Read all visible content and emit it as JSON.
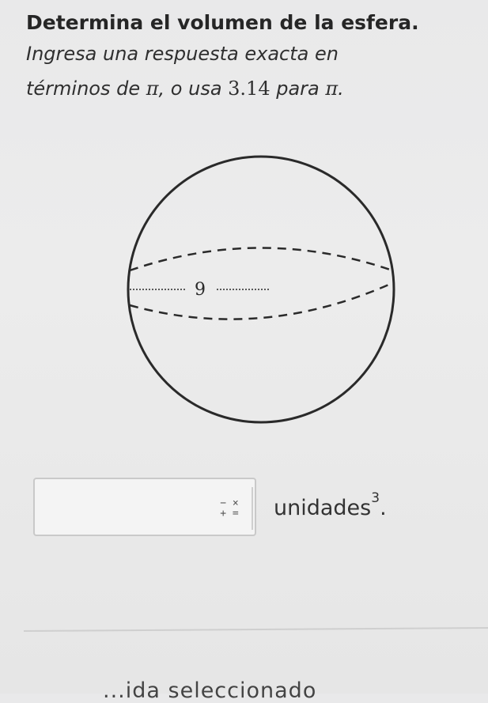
{
  "question": {
    "title": "Determina el volumen de la esfera.",
    "line1": "Ingresa una respuesta exacta en",
    "line2_prefix": "términos de ",
    "line2_pi": "π",
    "line2_mid": ", o usa ",
    "line2_num": "3.14",
    "line2_mid2": " para ",
    "line2_pi2": "π",
    "line2_end": "."
  },
  "figure": {
    "radius_label": "9"
  },
  "answer": {
    "value": "",
    "placeholder": "",
    "keypad_top": "− ×",
    "keypad_bottom": "+ =",
    "unit": "unidades",
    "unit_exponent": "3",
    "unit_suffix": "."
  },
  "footer": {
    "partial_text": "...ida seleccionado"
  },
  "colors": {
    "background": "#ececec",
    "stroke": "#2a2a2a",
    "input_border": "#c9c9c9"
  }
}
